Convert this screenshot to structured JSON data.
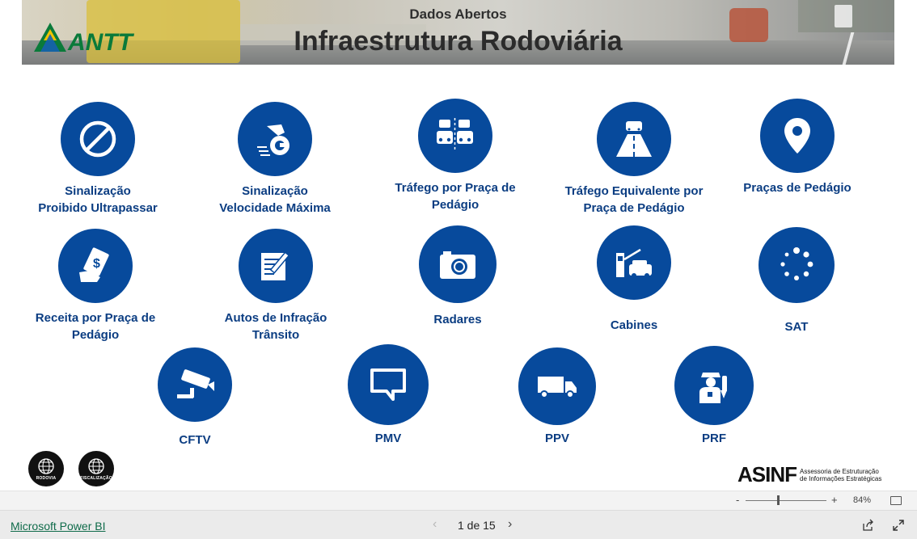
{
  "header": {
    "subtitle": "Dados Abertos",
    "title": "Infraestrutura Rodoviária",
    "logo_text": "ANTT"
  },
  "tiles": [
    {
      "icon": "no-overtaking-icon",
      "line1": "Sinalização",
      "line2": "Proibido Ultrapassar"
    },
    {
      "icon": "speedometer-icon",
      "line1": "Sinalização",
      "line2": "Velocidade Máxima"
    },
    {
      "icon": "traffic-icon",
      "line1": "Tráfego por Praça de",
      "line2": "Pedágio"
    },
    {
      "icon": "road-car-icon",
      "line1": "Tráfego Equivalente por",
      "line2": "Praça de Pedágio"
    },
    {
      "icon": "map-pin-icon",
      "line1": "Praças de Pedágio",
      "line2": ""
    },
    {
      "icon": "money-hand-icon",
      "line1": "Receita por Praça de",
      "line2": "Pedágio"
    },
    {
      "icon": "form-pen-icon",
      "line1": "Autos de Infração",
      "line2": "Trânsito"
    },
    {
      "icon": "camera-icon",
      "line1": "Radares",
      "line2": ""
    },
    {
      "icon": "toll-booth-icon",
      "line1": "Cabines",
      "line2": ""
    },
    {
      "icon": "dots-circle-icon",
      "line1": "SAT",
      "line2": ""
    },
    {
      "icon": "cctv-icon",
      "line1": "CFTV",
      "line2": ""
    },
    {
      "icon": "message-sign-icon",
      "line1": "PMV",
      "line2": ""
    },
    {
      "icon": "truck-icon",
      "line1": "PPV",
      "line2": ""
    },
    {
      "icon": "police-officer-icon",
      "line1": "PRF",
      "line2": ""
    }
  ],
  "footer": {
    "badge_rodovia": "RODOVIA",
    "badge_fiscalizacao": "FISCALIZAÇÃO",
    "asinf_big": "ASINF",
    "asinf_line1": "Assessoria de Estruturação",
    "asinf_line2": "de Informações Estratégicas"
  },
  "zoom": {
    "minus": "-",
    "plus": "+",
    "percent": "84%",
    "level": 0.4
  },
  "bottombar": {
    "link": "Microsoft Power BI",
    "page_info": "1 de 15",
    "prev": "‹",
    "next": "›"
  },
  "colors": {
    "accent": "#074a9c",
    "label": "#0b3d82"
  }
}
